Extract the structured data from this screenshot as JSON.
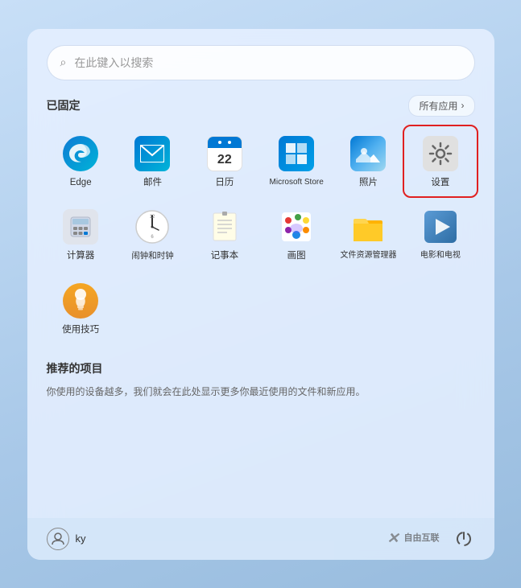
{
  "search": {
    "placeholder": "在此键入以搜索"
  },
  "pinned": {
    "title": "已固定",
    "all_apps_label": "所有应用",
    "chevron": "›",
    "apps": [
      {
        "id": "edge",
        "label": "Edge",
        "icon_type": "edge"
      },
      {
        "id": "mail",
        "label": "邮件",
        "icon_type": "mail"
      },
      {
        "id": "calendar",
        "label": "日历",
        "icon_type": "calendar",
        "cal_date": "22"
      },
      {
        "id": "store",
        "label": "Microsoft Store",
        "icon_type": "store"
      },
      {
        "id": "photos",
        "label": "照片",
        "icon_type": "photos"
      },
      {
        "id": "settings",
        "label": "设置",
        "icon_type": "settings",
        "highlighted": true
      },
      {
        "id": "calculator",
        "label": "计算器",
        "icon_type": "calculator"
      },
      {
        "id": "clock",
        "label": "闹钟和时钟",
        "icon_type": "clock"
      },
      {
        "id": "notepad",
        "label": "记事本",
        "icon_type": "notepad"
      },
      {
        "id": "paint",
        "label": "画图",
        "icon_type": "paint"
      },
      {
        "id": "files",
        "label": "文件资源管理器",
        "icon_type": "files"
      },
      {
        "id": "movies",
        "label": "电影和电视",
        "icon_type": "movies"
      },
      {
        "id": "tips",
        "label": "使用技巧",
        "icon_type": "tips"
      }
    ]
  },
  "recommended": {
    "title": "推荐的项目",
    "empty_text": "你使用的设备越多，我们就会在此处显示更多你最近使用的文件和新应用。"
  },
  "taskbar": {
    "user_name": "ky",
    "watermark_x": "✕",
    "watermark_brand": "自由互联",
    "power_icon": "⏻"
  }
}
